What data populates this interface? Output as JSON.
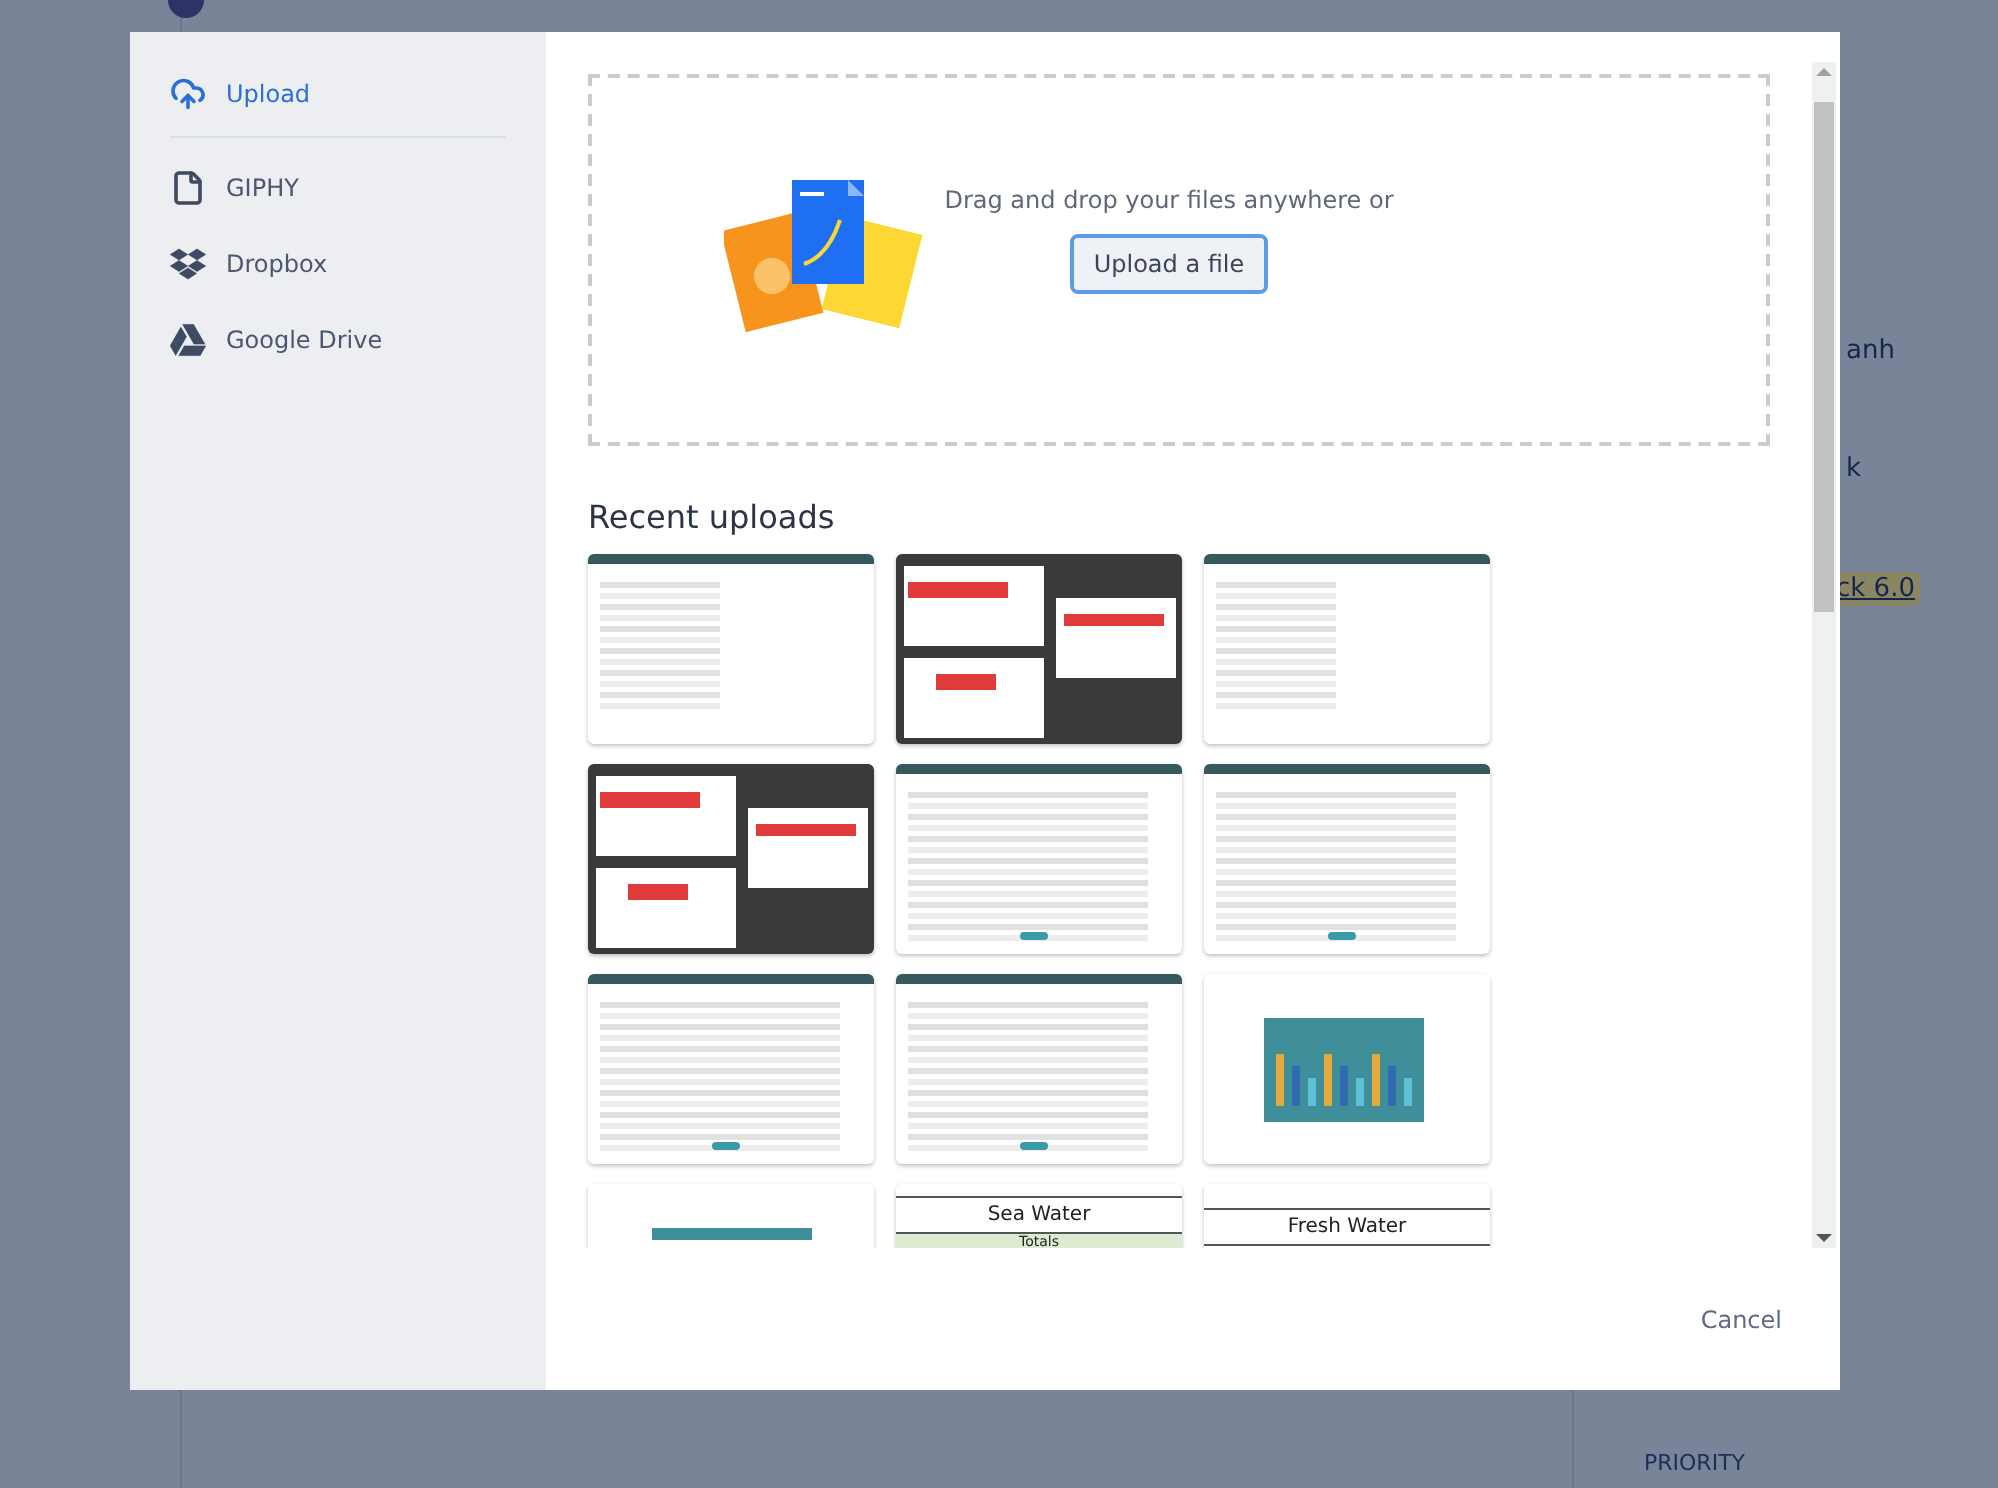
{
  "background_page": {
    "side_texts": [
      {
        "text": "anh",
        "kind": "link"
      },
      {
        "text": "k",
        "kind": "link"
      },
      {
        "text": "ck 6.0",
        "kind": "highlight"
      }
    ],
    "section_label": "PRIORITY"
  },
  "sidebar": {
    "items": [
      {
        "label": "Upload",
        "selected": true
      },
      {
        "label": "GIPHY",
        "selected": false
      },
      {
        "label": "Dropbox",
        "selected": false
      },
      {
        "label": "Google Drive",
        "selected": false
      }
    ]
  },
  "dropzone": {
    "prompt": "Drag and drop your files anywhere or",
    "button": "Upload a file"
  },
  "recent": {
    "title": "Recent uploads",
    "items": [
      {
        "kind": "list"
      },
      {
        "kind": "overlay"
      },
      {
        "kind": "list"
      },
      {
        "kind": "overlay"
      },
      {
        "kind": "table"
      },
      {
        "kind": "table"
      },
      {
        "kind": "table"
      },
      {
        "kind": "table"
      },
      {
        "kind": "chart"
      },
      {
        "kind": "banner"
      },
      {
        "kind": "sheet",
        "title": "Sea Water",
        "subtitle": "Totals"
      },
      {
        "kind": "sheet",
        "title": "Fresh Water"
      }
    ]
  },
  "footer": {
    "cancel": "Cancel"
  }
}
